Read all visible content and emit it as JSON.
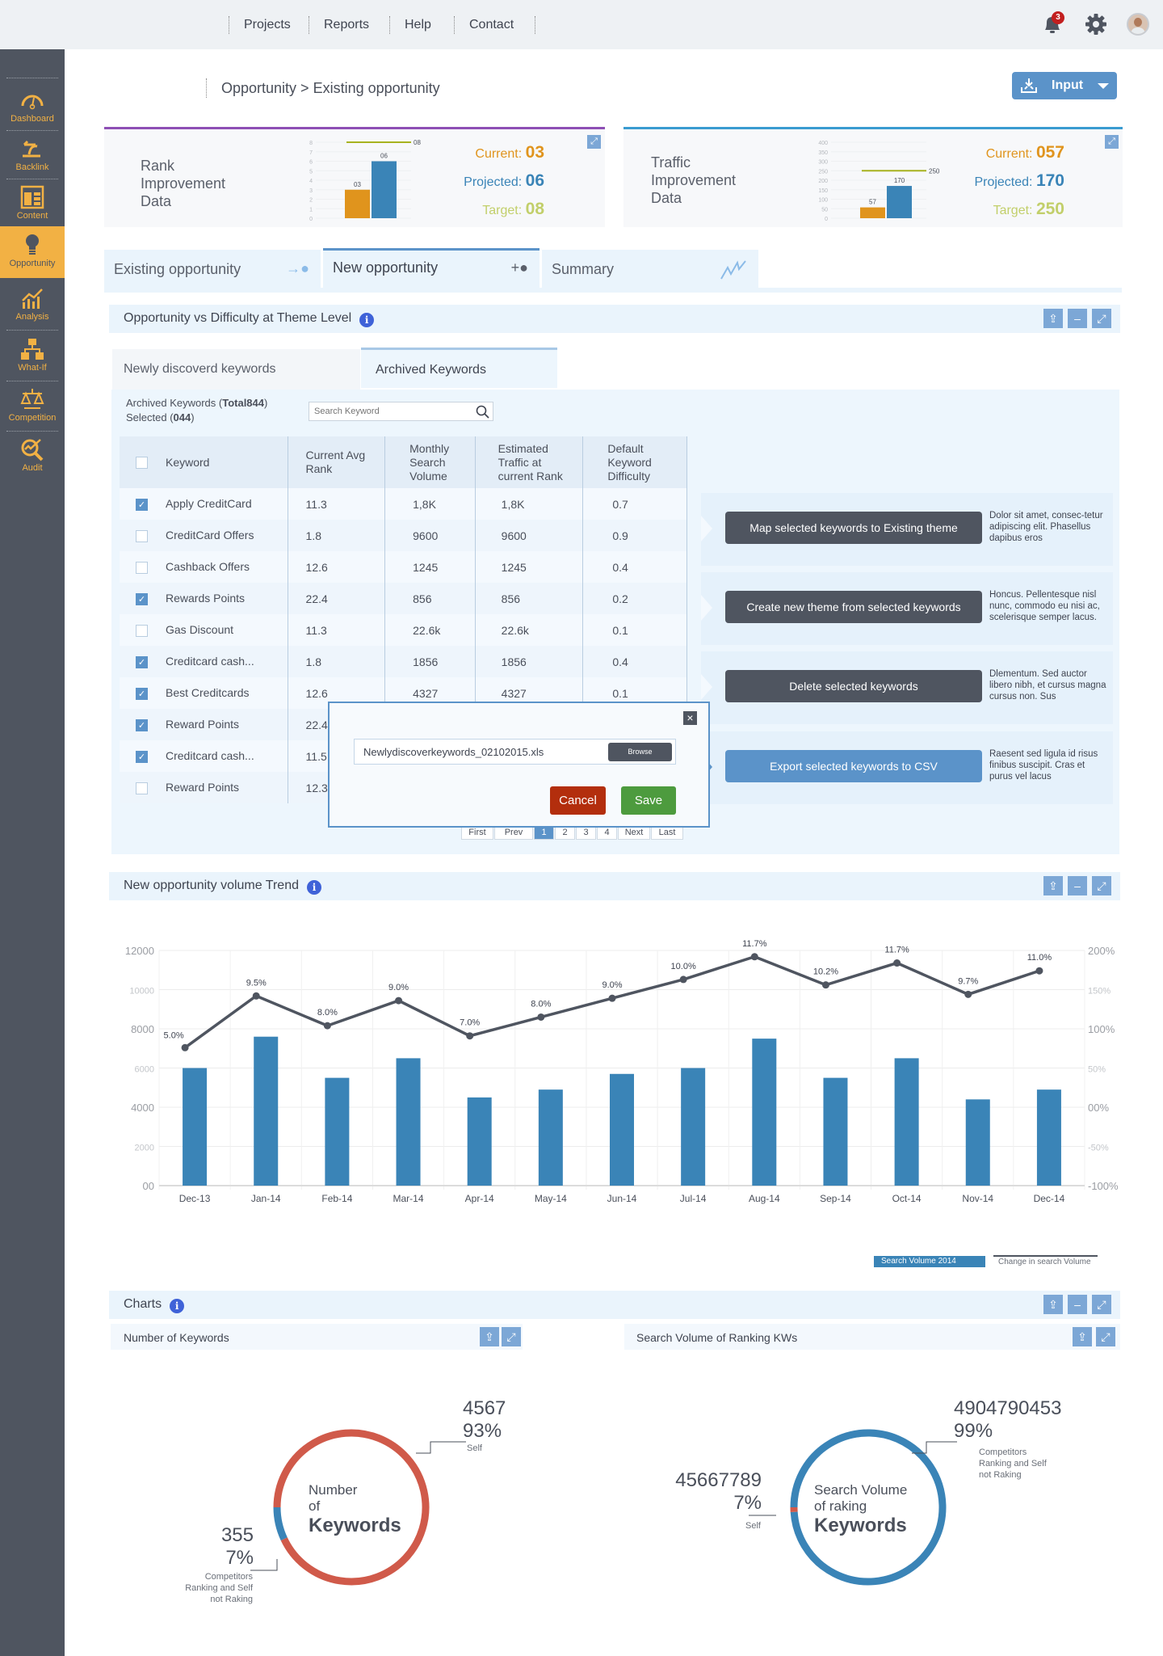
{
  "topnav": {
    "items": [
      "Projects",
      "Reports",
      "Help",
      "Contact"
    ],
    "notifications_count": "3"
  },
  "sidebar": {
    "items": [
      {
        "label": "Dashboard",
        "icon": "gauge-icon"
      },
      {
        "label": "Backlink",
        "icon": "backlink-icon"
      },
      {
        "label": "Content",
        "icon": "content-layout-icon"
      },
      {
        "label": "Opportunity",
        "icon": "lightbulb-icon",
        "active": true
      },
      {
        "label": "Analysis",
        "icon": "analysis-chart-icon"
      },
      {
        "label": "What-If",
        "icon": "hierarchy-icon"
      },
      {
        "label": "Competition",
        "icon": "scales-icon"
      },
      {
        "label": "Audit",
        "icon": "magnifier-chart-icon"
      }
    ]
  },
  "breadcrumb": "Opportunity > Existing opportunity",
  "input_button": {
    "label": "Input"
  },
  "cards": [
    {
      "title_lines": [
        "Rank",
        "Improvement",
        "Data"
      ],
      "current_label": "Current:",
      "current": "03",
      "projected_label": "Projected:",
      "projected": "06",
      "target_label": "Target:",
      "target": "08",
      "accent": "#8e4fb5"
    },
    {
      "title_lines": [
        "Traffic",
        "Improvement",
        "Data"
      ],
      "current_label": "Current:",
      "current": "057",
      "projected_label": "Projected:",
      "projected": "170",
      "target_label": "Target:",
      "target": "250",
      "accent": "#3a9bd1"
    }
  ],
  "tabs": [
    {
      "label": "Existing opportunity",
      "active": false
    },
    {
      "label": "New opportunity",
      "active": true
    },
    {
      "label": "Summary",
      "active": false
    }
  ],
  "opportunity_panel": {
    "title": "Opportunity vs Difficulty at Theme Level",
    "subtabs": [
      "Newly discoverd keywords",
      "Archived Keywords"
    ],
    "summary_prefix": "Archived Keywords (",
    "summary_total": "Total844",
    "summary_suffix": ")",
    "selected_prefix": "Selected (",
    "selected_value": "044",
    "selected_suffix": ")",
    "search_placeholder": "Search Keyword",
    "columns": [
      "Keyword",
      "Current Avg Rank",
      "Monthly Search Volume",
      "Estimated Traffic at current Rank",
      "Default Keyword Difficulty"
    ],
    "rows": [
      {
        "checked": true,
        "keyword": "Apply CreditCard",
        "rank": "11.3",
        "volume": "1,8K",
        "traffic": "1,8K",
        "difficulty": "0.7"
      },
      {
        "checked": false,
        "keyword": "CreditCard Offers",
        "rank": "1.8",
        "volume": "9600",
        "traffic": "9600",
        "difficulty": "0.9"
      },
      {
        "checked": false,
        "keyword": "Cashback Offers",
        "rank": "12.6",
        "volume": "1245",
        "traffic": "1245",
        "difficulty": "0.4"
      },
      {
        "checked": true,
        "keyword": "Rewards Points",
        "rank": "22.4",
        "volume": "856",
        "traffic": "856",
        "difficulty": "0.2"
      },
      {
        "checked": false,
        "keyword": "Gas Discount",
        "rank": "11.3",
        "volume": "22.6k",
        "traffic": "22.6k",
        "difficulty": "0.1"
      },
      {
        "checked": true,
        "keyword": "Creditcard cash...",
        "rank": "1.8",
        "volume": "1856",
        "traffic": "1856",
        "difficulty": "0.4"
      },
      {
        "checked": true,
        "keyword": "Best Creditcards",
        "rank": "12.6",
        "volume": "4327",
        "traffic": "4327",
        "difficulty": "0.1"
      },
      {
        "checked": true,
        "keyword": "Reward Points",
        "rank": "22.4",
        "volume": "",
        "traffic": "",
        "difficulty": ""
      },
      {
        "checked": true,
        "keyword": "Creditcard cash...",
        "rank": "11.5",
        "volume": "",
        "traffic": "",
        "difficulty": ""
      },
      {
        "checked": false,
        "keyword": "Reward Points",
        "rank": "12.3",
        "volume": "",
        "traffic": "",
        "difficulty": ""
      }
    ],
    "actions": [
      {
        "label": "Map selected keywords to Existing theme",
        "desc": "Dolor sit amet, consec-tetur adipiscing elit. Phasellus dapibus eros",
        "primary": false
      },
      {
        "label": "Create new theme from selected keywords",
        "desc": "Honcus. Pellentesque nisl nunc, commodo eu nisi ac, scelerisque semper lacus.",
        "primary": false
      },
      {
        "label": "Delete selected keywords",
        "desc": "Dlementum. Sed auctor libero nibh, et cursus magna cursus non. Sus",
        "primary": false
      },
      {
        "label": "Export selected keywords to CSV",
        "desc": "Raesent sed ligula id risus finibus suscipit. Cras et purus vel lacus",
        "primary": true
      }
    ],
    "pagination": [
      "First",
      "Prev",
      "1",
      "2",
      "3",
      "4",
      "Next",
      "Last"
    ],
    "current_page": "1"
  },
  "upload_modal": {
    "file_value": "Newlydiscoverkeywords_02102015.xls",
    "browse_label": "Browse",
    "cancel_label": "Cancel",
    "save_label": "Save"
  },
  "trend_panel": {
    "title": "New opportunity volume Trend"
  },
  "charts_panel": {
    "title": "Charts",
    "left_title": "Number of Keywords",
    "right_title": "Search Volume of Ranking KWs",
    "left_center": [
      "Number",
      "of",
      "Keywords"
    ],
    "right_center": [
      "Search Volume",
      "of raking",
      "Keywords"
    ],
    "left_big": {
      "value": "4567",
      "pct": "93%",
      "label": "Self"
    },
    "left_small": {
      "value": "355",
      "pct": "7%",
      "label": "Competitors Ranking and Self not Raking"
    },
    "right_big": {
      "value": "4904790453",
      "pct": "99%",
      "label": "Competitors Ranking and Self not Raking"
    },
    "right_small": {
      "value": "45667789",
      "pct": "7%",
      "label": "Self"
    }
  },
  "chart_data": [
    {
      "type": "bar",
      "title": "Rank Improvement Data",
      "categories": [
        "Current",
        "Projected"
      ],
      "values": [
        3,
        6
      ],
      "target": 8,
      "data_labels": [
        "03",
        "06",
        "08"
      ],
      "yticks": [
        0,
        1,
        2,
        3,
        4,
        5,
        6,
        7,
        8
      ],
      "ylim": [
        0,
        8
      ]
    },
    {
      "type": "bar",
      "title": "Traffic Improvement Data",
      "categories": [
        "Current",
        "Projected"
      ],
      "values": [
        57,
        170
      ],
      "target": 250,
      "data_labels": [
        "57",
        "170",
        "250"
      ],
      "yticks": [
        0,
        50,
        100,
        150,
        200,
        250,
        300,
        350,
        400
      ],
      "ylim": [
        0,
        400
      ]
    },
    {
      "type": "bar",
      "title": "New opportunity volume Trend",
      "categories": [
        "Dec-13",
        "Jan-14",
        "Feb-14",
        "Mar-14",
        "Apr-14",
        "May-14",
        "Jun-14",
        "Jul-14",
        "Aug-14",
        "Sep-14",
        "Oct-14",
        "Nov-14",
        "Dec-14"
      ],
      "series": [
        {
          "name": "Search Volume 2014",
          "type": "bar",
          "axis": "left",
          "values": [
            6000,
            7600,
            5500,
            6500,
            4500,
            4900,
            5700,
            6000,
            7500,
            5500,
            6500,
            4400,
            4900
          ]
        },
        {
          "name": "Change in search Volume",
          "type": "line",
          "axis": "right",
          "values": [
            76,
            142,
            104,
            136,
            91,
            115,
            139,
            163,
            192,
            156,
            184,
            144,
            174
          ],
          "point_labels": [
            "5.0%",
            "9.5%",
            "8.0%",
            "9.0%",
            "7.0%",
            "8.0%",
            "9.0%",
            "10.0%",
            "11.7%",
            "10.2%",
            "11.7%",
            "9.7%",
            "11.0%"
          ]
        }
      ],
      "left_ticks": [
        "00",
        "2000",
        "4000",
        "6000",
        "8000",
        "10000",
        "12000"
      ],
      "left_ylim": [
        0,
        12000
      ],
      "right_ticks": [
        "-100%",
        "-50%",
        "00%",
        "50%",
        "100%",
        "150%",
        "200%"
      ],
      "right_ylim": [
        -100,
        200
      ],
      "legend": "bottom-right",
      "grid": true
    },
    {
      "type": "pie",
      "title": "Number of Keywords",
      "labels": [
        "Self",
        "Competitors Ranking and Self not Raking"
      ],
      "values": [
        4567,
        355
      ],
      "percents": [
        93,
        7
      ],
      "colors": [
        "#d05a4a",
        "#3a84b7"
      ]
    },
    {
      "type": "pie",
      "title": "Search Volume of Ranking KWs",
      "labels": [
        "Competitors Ranking and Self not Raking",
        "Self"
      ],
      "values": [
        4904790453,
        45667789
      ],
      "percents": [
        99,
        1
      ],
      "colors": [
        "#3a84b7",
        "#d05a4a"
      ]
    }
  ]
}
